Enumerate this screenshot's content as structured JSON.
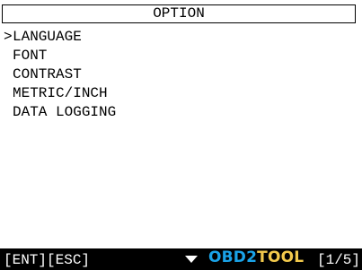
{
  "header": {
    "title": "OPTION"
  },
  "menu": {
    "selected_index": 0,
    "cursor": ">",
    "items": [
      {
        "label": "LANGUAGE"
      },
      {
        "label": "FONT"
      },
      {
        "label": "CONTRAST"
      },
      {
        "label": "METRIC/INCH"
      },
      {
        "label": "DATA LOGGING"
      }
    ]
  },
  "footer": {
    "keys": "[ENT][ESC]",
    "scroll_icon": "triangle-down-icon",
    "watermark": {
      "part1": "OBD2",
      "part2": "TOOL"
    },
    "page": "[1/5]"
  },
  "colors": {
    "background": "#ffffff",
    "text": "#000000",
    "footer_background": "#000000",
    "footer_text": "#ffffff",
    "watermark_blue": "#1aa3e8",
    "watermark_yellow": "#f2c94c"
  }
}
